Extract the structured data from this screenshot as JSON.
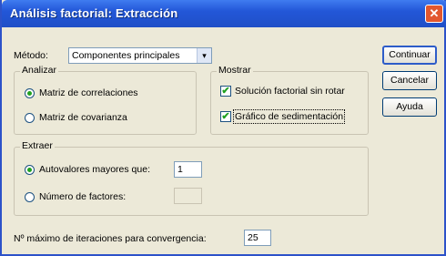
{
  "window": {
    "title": "Análisis factorial: Extracción",
    "close_glyph": "✕"
  },
  "metodo": {
    "label": "Método:",
    "value": "Componentes principales",
    "arrow": "▾"
  },
  "analizar": {
    "legend": "Analizar",
    "options": [
      "Matriz de correlaciones",
      "Matriz de covarianza"
    ],
    "selected": 0
  },
  "mostrar": {
    "legend": "Mostrar",
    "items": [
      {
        "label": "Solución factorial sin rotar",
        "checked": true
      },
      {
        "label": "Gráfico de sedimentación",
        "checked": true
      }
    ],
    "check_glyph": "✔"
  },
  "extraer": {
    "legend": "Extraer",
    "autovalores_label": "Autovalores mayores que:",
    "autovalores_value": "1",
    "numero_label": "Número de factores:",
    "numero_value": ""
  },
  "iteraciones": {
    "label": "Nº máximo de iteraciones para convergencia:",
    "value": "25"
  },
  "buttons": {
    "continuar": "Continuar",
    "cancelar": "Cancelar",
    "ayuda": "Ayuda"
  },
  "colors": {
    "title_bar": "#2357d8",
    "dialog_bg": "#ece9d8",
    "close_button": "#e2572f"
  }
}
